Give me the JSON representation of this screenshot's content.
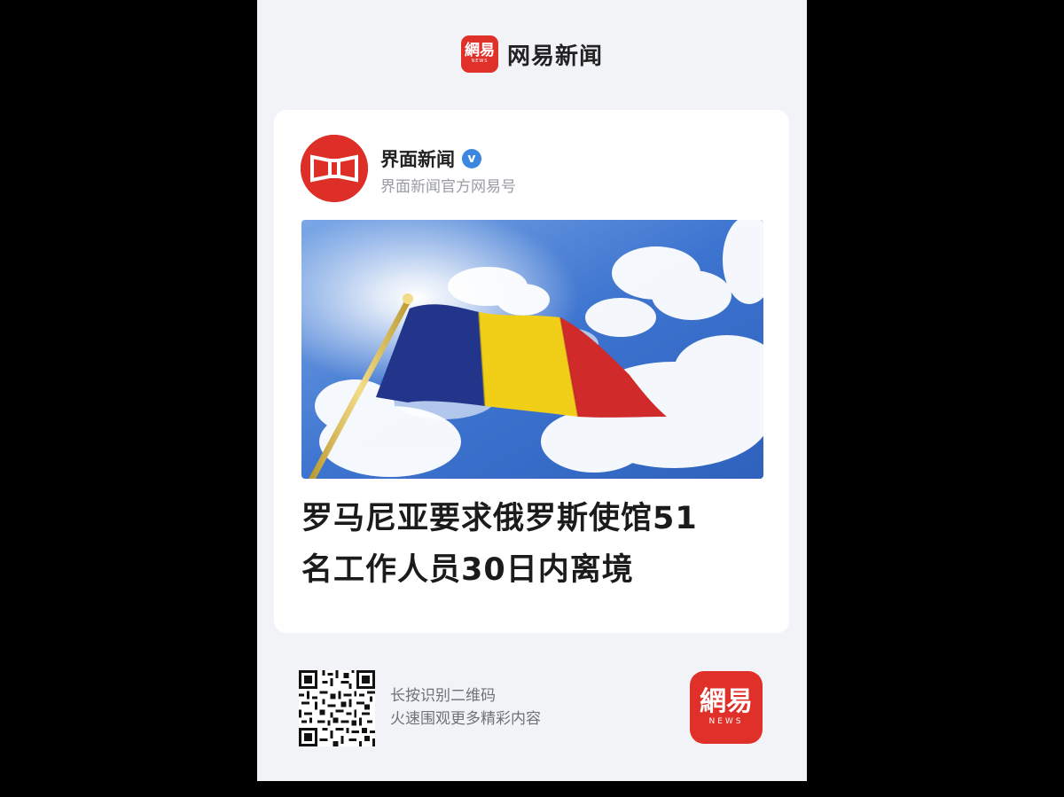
{
  "header": {
    "app_logo": {
      "text": "網易",
      "sub": "NEWS"
    },
    "app_name": "网易新闻"
  },
  "article": {
    "author": {
      "name": "界面新闻",
      "verified_mark": "v",
      "subtitle": "界面新闻官方网易号"
    },
    "headline_line1": "罗马尼亚要求俄罗斯使馆51",
    "headline_line2": "名工作人员30日内离境"
  },
  "footer": {
    "line1": "长按识别二维码",
    "line2": "火速围观更多精彩内容",
    "app_logo": {
      "text": "網易",
      "sub": "NEWS"
    }
  },
  "colors": {
    "brand_red": "#e0302a",
    "verified_blue": "#3a86e0",
    "flag_blue": "#1f3a93",
    "flag_yellow": "#f5d40f",
    "flag_red": "#d12a2a"
  }
}
